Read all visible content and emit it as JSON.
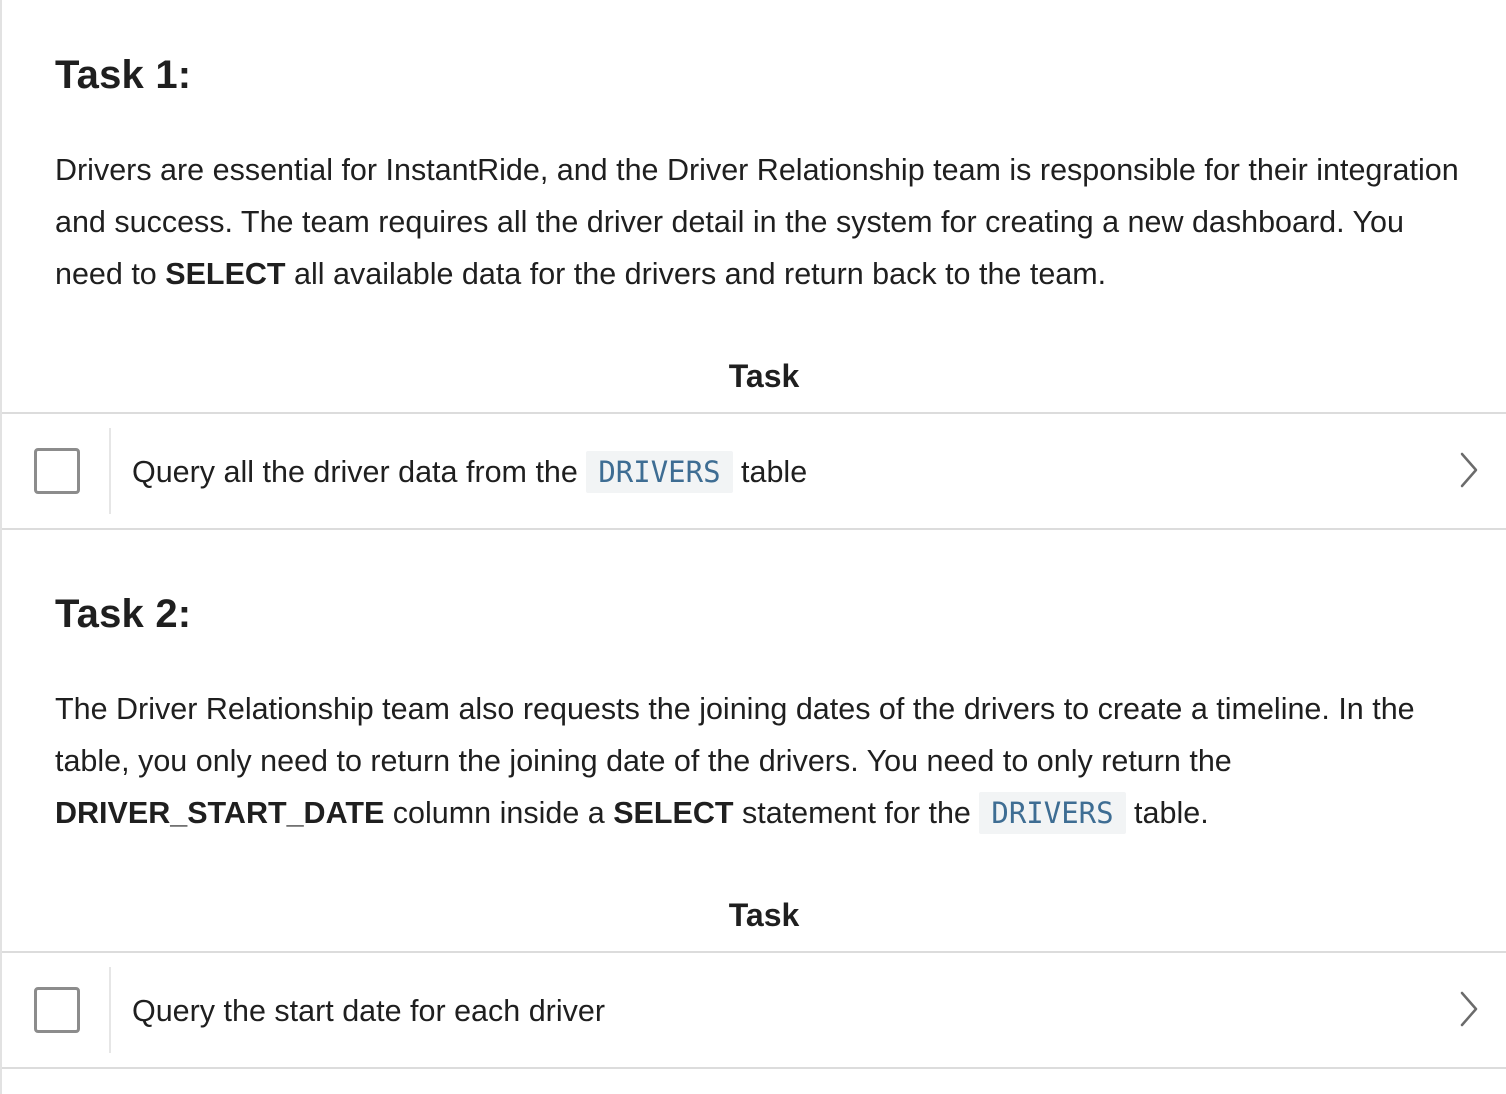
{
  "task1": {
    "heading": "Task 1:",
    "desc_part1": "Drivers are essential for InstantRide, and the Driver Relationship team is responsible for their integration and success. The team requires all the driver detail in the system for creating a new dashboard. You need to ",
    "desc_bold1": "SELECT",
    "desc_part2": " all available data for the drivers and return back to the team.",
    "column_header": "Task",
    "item_text_before": "Query all the driver data from the ",
    "item_code": "DRIVERS",
    "item_text_after": " table",
    "checked": false
  },
  "task2": {
    "heading": "Task 2:",
    "desc_part1": "The Driver Relationship team also requests the joining dates of the drivers to create a timeline. In the table, you only need to return the joining date of the drivers. You need to only return the ",
    "desc_bold1": "DRIVER_START_DATE",
    "desc_part2": " column inside a ",
    "desc_bold2": "SELECT",
    "desc_part3": " statement for the ",
    "desc_code": "DRIVERS",
    "desc_part4": " table.",
    "column_header": "Task",
    "item_text": "Query the start date for each driver",
    "checked": false
  },
  "icons": {
    "checkbox": "checkbox-icon",
    "chevron": "chevron-right-icon"
  },
  "colors": {
    "text": "#1f1f1f",
    "code_text": "#3e6d93",
    "code_bg": "#f2f4f5",
    "border": "#dcdcdc",
    "checkbox_border": "#8c8c8c"
  }
}
